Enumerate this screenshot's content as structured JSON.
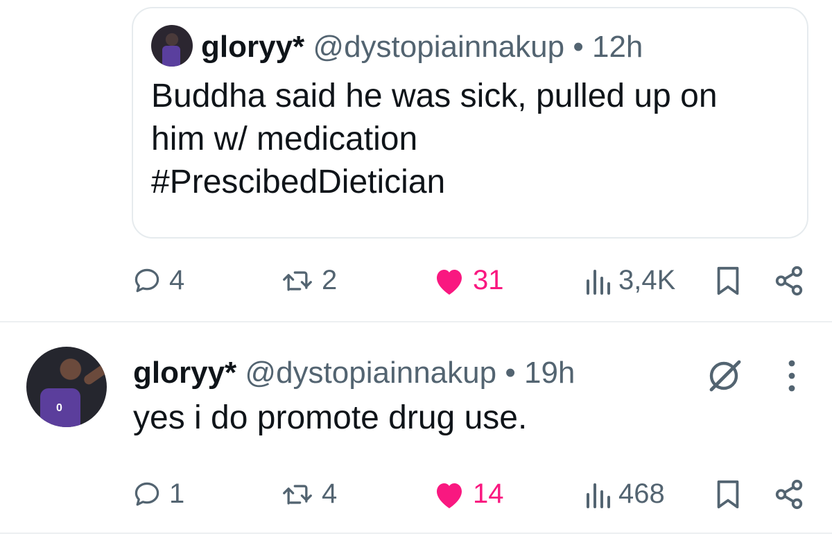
{
  "quoted_tweet": {
    "display_name": "gloryy*",
    "handle": "@dystopiainnakup",
    "separator": "•",
    "time": "12h",
    "lines": [
      "Buddha said he was sick, pulled up on",
      "him w/ medication",
      "#PrescibedDietician"
    ]
  },
  "tweet1_actions": {
    "replies": "4",
    "reposts": "2",
    "likes": "31",
    "views": "3,4K"
  },
  "tweet2": {
    "display_name": "gloryy*",
    "handle": "@dystopiainnakup",
    "separator": "•",
    "time": "19h",
    "text": "yes i do promote drug use."
  },
  "tweet2_actions": {
    "replies": "1",
    "reposts": "4",
    "likes": "14",
    "views": "468"
  },
  "colors": {
    "like": "#f91880",
    "secondary": "#536471",
    "primary": "#0f1419",
    "border": "#e6ebee"
  }
}
